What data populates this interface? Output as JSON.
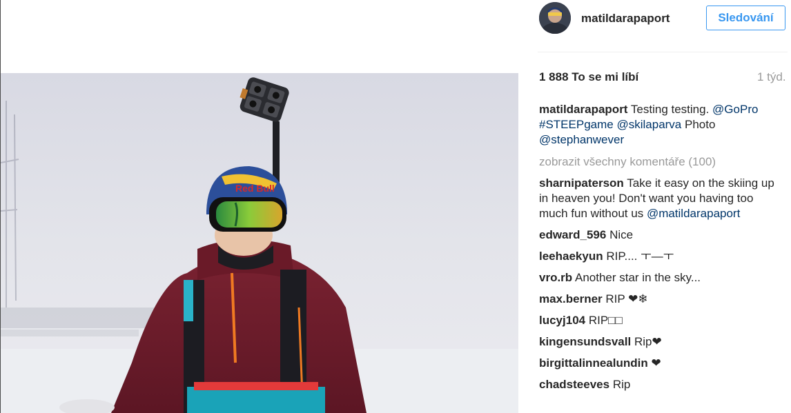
{
  "post": {
    "username": "matildarapaport",
    "follow_label": "Sledování",
    "likes": "1 888 To se mi líbí",
    "time": "1 týd.",
    "caption": {
      "user": "matildarapaport",
      "text": "Testing testing.",
      "tags": [
        "@GoPro",
        "#STEEPgame",
        "@skilaparva",
        "@stephanwever"
      ],
      "between_text": "Photo"
    },
    "view_all_comments": "zobrazit všechny komentáře (100)",
    "comments": [
      {
        "user": "sharnipaterson",
        "text": "Take it easy on the skiing up in heaven you! Don't want you having too much fun without us",
        "mention": "@matildarapaport"
      },
      {
        "user": "edward_596",
        "text": "Nice"
      },
      {
        "user": "leehaekyun",
        "text": "RIP.... ㅜ—ㅜ"
      },
      {
        "user": "vro.rb",
        "text": "Another star in the sky..."
      },
      {
        "user": "max.berner",
        "text": "RIP ❤❄"
      },
      {
        "user": "lucyj104",
        "text": "RIP□□"
      },
      {
        "user": "kingensundsvall",
        "text": "Rip❤"
      },
      {
        "user": "birgittalinnealundin",
        "text": "❤"
      },
      {
        "user": "chadsteeves",
        "text": "Rip"
      }
    ]
  },
  "photo": {
    "helmet_brand": "Red Bull",
    "colors": {
      "sky": "#e3e4ea",
      "jacket": "#6e1d2b",
      "helmet": "#2c4f9a"
    }
  }
}
